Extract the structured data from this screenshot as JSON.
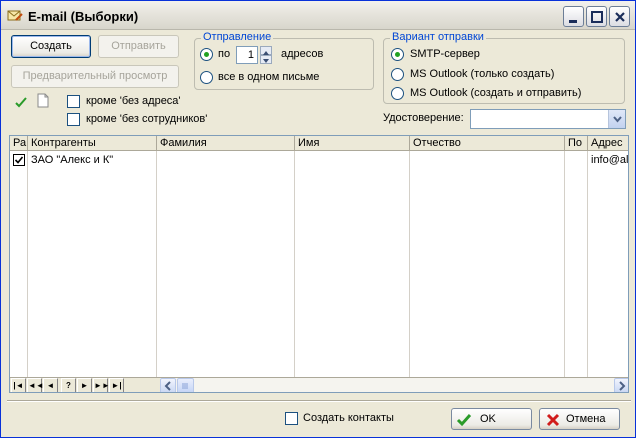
{
  "window": {
    "title": "E-mail (Выборки)",
    "icon": "email-edit-icon"
  },
  "toolbar": {
    "create_label": "Создать",
    "send_label": "Отправить",
    "preview_label": "Предварительный просмотр"
  },
  "filters": {
    "no_address_label": "кроме 'без адреса'",
    "no_address_checked": false,
    "no_employees_label": "кроме 'без сотрудников'",
    "no_employees_checked": false
  },
  "sending": {
    "group_label": "Отправление",
    "by_label": "по",
    "count_value": "1",
    "addresses_label": "адресов",
    "single_letter_label": "все в одном письме",
    "selected": "by"
  },
  "send_variant": {
    "group_label": "Вариант отправки",
    "options": [
      "SMTP-сервер",
      "MS Outlook (только создать)",
      "MS Outlook (создать и отправить)"
    ],
    "selected_index": 0
  },
  "certificate": {
    "label": "Удостоверение:",
    "value": ""
  },
  "grid": {
    "columns": [
      "Ра",
      "Контрагенты",
      "Фамилия",
      "Имя",
      "Отчество",
      "По",
      "Адрес"
    ],
    "rows": [
      {
        "checked": true,
        "counterparty": "ЗАО \"Алекс и К\"",
        "surname": "",
        "name": "",
        "patronymic": "",
        "gender": "",
        "address": "info@ale"
      }
    ]
  },
  "navigator": {
    "buttons": [
      "|◄",
      "◄◄",
      "◄",
      "?",
      "►",
      "►►",
      "►|"
    ]
  },
  "footer": {
    "create_contacts_label": "Создать контакты",
    "create_contacts_checked": false,
    "ok_label": "OK",
    "cancel_label": "Отмена"
  },
  "colors": {
    "window_bg": "#ece9d8",
    "group_label": "#0046d5",
    "radio_dot": "#21a121",
    "ok_icon": "#2a9b2a",
    "cancel_icon": "#d11c1c"
  }
}
